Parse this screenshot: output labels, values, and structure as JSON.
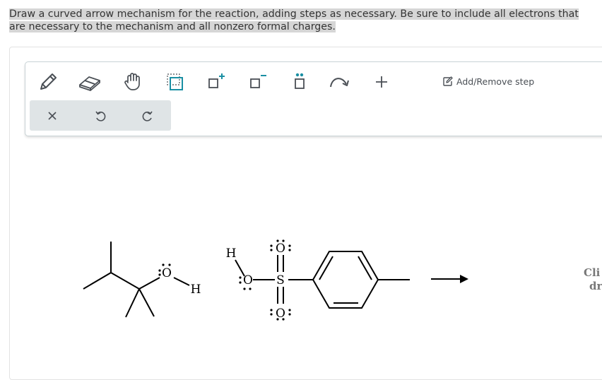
{
  "question": {
    "text": "Draw a curved arrow mechanism for the reaction, adding steps as necessary. Be sure to include all electrons that are necessary to the mechanism and all nonzero formal charges."
  },
  "toolbar": {
    "tools": [
      {
        "name": "pencil-icon"
      },
      {
        "name": "eraser-icon"
      },
      {
        "name": "hand-icon"
      },
      {
        "name": "select-box-icon"
      },
      {
        "name": "positive-charge-icon"
      },
      {
        "name": "negative-charge-icon"
      },
      {
        "name": "lone-pair-icon"
      },
      {
        "name": "curved-arrow-icon"
      },
      {
        "name": "plus-icon"
      }
    ],
    "add_remove_step_label": "Add/Remove step",
    "sub_tools": [
      {
        "name": "clear-icon"
      },
      {
        "name": "undo-icon"
      },
      {
        "name": "redo-icon"
      }
    ]
  },
  "molecules": {
    "alcohol": {
      "oxygen": "O",
      "hydrogen": "H"
    },
    "tsoh": {
      "hydrogen": "H",
      "oxygen_oh": "O",
      "sulfur": "S",
      "oxygen_top": "O",
      "oxygen_bottom": "O"
    }
  },
  "hint": {
    "line1": "Cli",
    "line2": "dr"
  },
  "colors": {
    "accent": "#1a8fa3",
    "toolbar_border": "#c9d3d6",
    "subbar": "#dfe4e6",
    "highlight": "#d6d6d6"
  }
}
